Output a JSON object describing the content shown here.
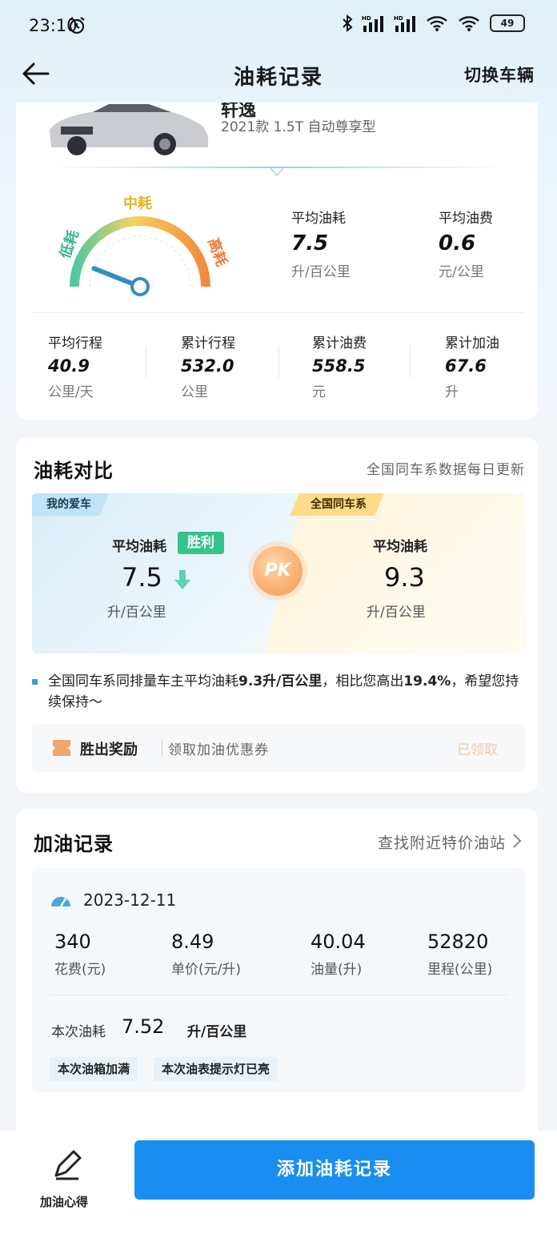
{
  "status_bar": {
    "time": "23:10",
    "hd1": "HD",
    "hd2": "HD",
    "battery": "49"
  },
  "header": {
    "title": "油耗记录",
    "right_action": "切换车辆"
  },
  "car": {
    "name": "轩逸",
    "model": "2021款 1.5T 自动尊享型"
  },
  "gauge": {
    "low": "低耗",
    "mid": "中耗",
    "high": "高耗",
    "level": 0.12
  },
  "summary": {
    "avg_consumption": {
      "label": "平均油耗",
      "value": "7.5",
      "unit": "升/百公里"
    },
    "avg_cost": {
      "label": "平均油费",
      "value": "0.6",
      "unit": "元/公里"
    }
  },
  "stats": [
    {
      "label": "平均行程",
      "value": "40.9",
      "unit": "公里/天"
    },
    {
      "label": "累计行程",
      "value": "532.0",
      "unit": "公里"
    },
    {
      "label": "累计油费",
      "value": "558.5",
      "unit": "元"
    },
    {
      "label": "累计加油",
      "value": "67.6",
      "unit": "升"
    }
  ],
  "compare": {
    "title": "油耗对比",
    "subtitle": "全国同车系数据每日更新",
    "left_tag": "我的爱车",
    "right_tag": "全国同车系",
    "my_label": "平均油耗",
    "win_badge": "胜利",
    "my_value": "7.5",
    "my_unit": "升/百公里",
    "pk": "PK",
    "nat_label": "平均油耗",
    "nat_value": "9.3",
    "nat_unit": "升/百公里",
    "note_a": "全国同车系同排量车主平均油耗",
    "note_b": "9.3升/百公里",
    "note_c": "，相比您高出",
    "note_d": "19.4%",
    "note_e": "，希望您持续保持～",
    "reward_title": "胜出奖励",
    "reward_text": "领取加油优惠券",
    "reward_status": "已领取"
  },
  "records": {
    "title": "加油记录",
    "link": "查找附近特价油站",
    "date": "2023-12-11",
    "items": [
      {
        "value": "340",
        "label": "花费(元)"
      },
      {
        "value": "8.49",
        "label": "单价(元/升)"
      },
      {
        "value": "40.04",
        "label": "油量(升)"
      },
      {
        "value": "52820",
        "label": "里程(公里)"
      }
    ],
    "consumption_label": "本次油耗",
    "consumption_value": "7.52",
    "consumption_unit": "升/百公里",
    "chips": [
      "本次油箱加满",
      "本次油表提示灯已亮"
    ]
  },
  "bottom": {
    "notes_label": "加油心得",
    "add_button": "添加油耗记录"
  },
  "colors": {
    "primary": "#1a8ef0",
    "win": "#34c38a",
    "pk": "#f8a867"
  }
}
